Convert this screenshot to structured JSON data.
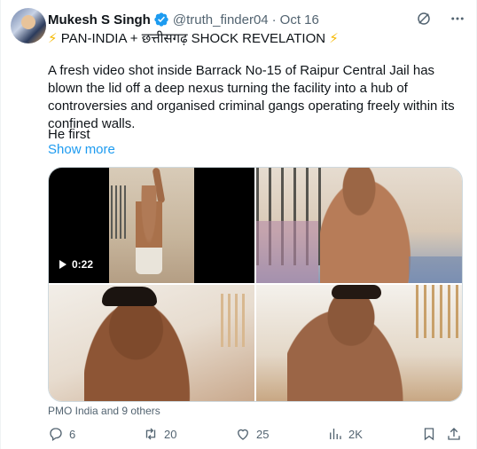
{
  "author": {
    "name": "Mukesh S Singh",
    "handle": "@truth_finder04",
    "separator": "·",
    "date": "Oct 16"
  },
  "icons": {
    "verified": "verified-badge-icon",
    "grok": "grok-icon",
    "more": "more-icon",
    "reply": "reply-icon",
    "retweet": "retweet-icon",
    "like": "like-icon",
    "views": "views-icon",
    "bookmark": "bookmark-icon",
    "share": "share-icon"
  },
  "tweet": {
    "headline_emoji": "⚡",
    "headline": "PAN-INDIA + छत्तीसगढ़ SHOCK REVELATION",
    "headline_emoji_end": "⚡",
    "body": "A fresh video shot inside Barrack No-15 of Raipur Central Jail has blown the lid off a deep nexus turning the facility into a hub of controversies and organised criminal gangs operating freely within its confined walls.",
    "body2": "He first",
    "show_more": "Show more"
  },
  "media": {
    "video_duration": "0:22"
  },
  "liked_by": "PMO India and 9 others",
  "stats": {
    "replies": "6",
    "retweets": "20",
    "likes": "25",
    "views": "2K"
  },
  "colors": {
    "accent": "#1d9bf0",
    "secondary_text": "#536471",
    "bolt": "#f5b800"
  }
}
